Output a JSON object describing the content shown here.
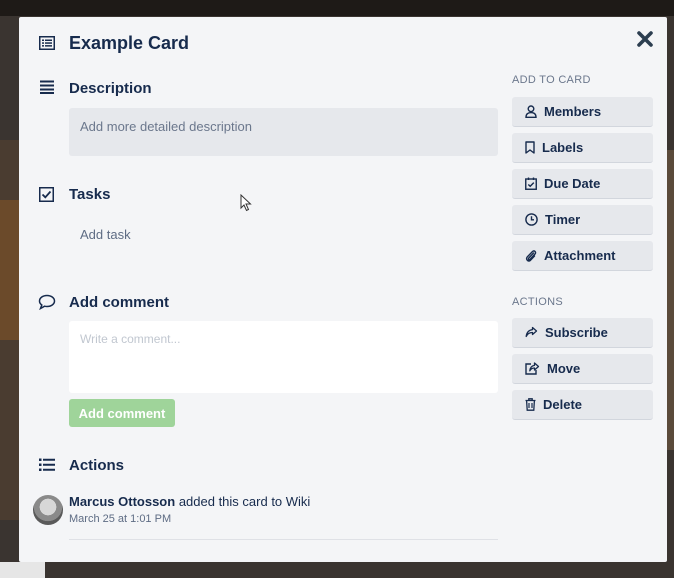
{
  "card": {
    "title": "Example Card"
  },
  "description": {
    "title": "Description",
    "placeholder": "Add more detailed description"
  },
  "tasks": {
    "title": "Tasks",
    "add_label": "Add task"
  },
  "comment": {
    "title": "Add comment",
    "placeholder": "Write a comment...",
    "button_label": "Add comment"
  },
  "actions_log": {
    "title": "Actions",
    "entries": [
      {
        "user": "Marcus Ottosson",
        "text": "added this card to Wiki",
        "time": "March 25 at 1:01 PM"
      }
    ]
  },
  "sidebar": {
    "add_heading": "ADD TO CARD",
    "add_items": [
      {
        "label": "Members",
        "icon": "person-icon"
      },
      {
        "label": "Labels",
        "icon": "bookmark-icon"
      },
      {
        "label": "Due Date",
        "icon": "calendar-icon"
      },
      {
        "label": "Timer",
        "icon": "clock-icon"
      },
      {
        "label": "Attachment",
        "icon": "paperclip-icon"
      }
    ],
    "actions_heading": "ACTIONS",
    "action_items": [
      {
        "label": "Subscribe",
        "icon": "share-icon"
      },
      {
        "label": "Move",
        "icon": "move-icon"
      },
      {
        "label": "Delete",
        "icon": "trash-icon"
      }
    ]
  },
  "colors": {
    "modal_bg": "#f4f5f7",
    "accent_green": "#9fd49a",
    "text_dark": "#172b4d",
    "text_muted": "#6b778c"
  }
}
